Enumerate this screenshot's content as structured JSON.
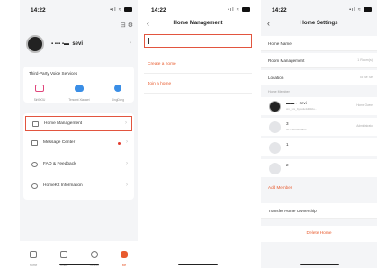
{
  "status": {
    "time": "14:22",
    "signal": "•ıl ≈"
  },
  "screen1": {
    "profile_name": "sevi",
    "voice_section_title": "Third-Party Voice Services",
    "voice_services": [
      {
        "label": "Siri/DOU",
        "color": "#e0457b"
      },
      {
        "label": "Tencent Xiaowei",
        "color": "#3a8ee6"
      },
      {
        "label": "DingDong",
        "color": "#3a8ee6"
      }
    ],
    "menu": [
      {
        "label": "Home Management"
      },
      {
        "label": "Message Center"
      },
      {
        "label": "FAQ & Feedback"
      },
      {
        "label": "HomeKit Information"
      }
    ],
    "tabs": [
      {
        "label": "Home"
      },
      {
        "label": "Smart"
      },
      {
        "label": "Service"
      },
      {
        "label": "Me"
      }
    ]
  },
  "screen2": {
    "title": "Home Management",
    "input_value": "",
    "create_label": "Create a home",
    "join_label": "Join a home"
  },
  "screen3": {
    "title": "Home Settings",
    "rows": [
      {
        "label": "Home Name",
        "value": ""
      },
      {
        "label": "Room Management",
        "value": "1 Room(s)"
      },
      {
        "label": "Location",
        "value": "To Be Se"
      }
    ],
    "members_section": "Home Member",
    "members": [
      {
        "name": "sevi",
        "sub": "cm_xxx_bycxdu4d0S0u...",
        "role": "Home Owner"
      },
      {
        "name": "3",
        "sub": "00 10003300804",
        "role": "Administrator"
      },
      {
        "name": "1",
        "sub": "",
        "role": ""
      },
      {
        "name": "2",
        "sub": "",
        "role": ""
      }
    ],
    "add_member": "Add Member",
    "transfer": "Transfer Home Ownership",
    "delete": "Delete Home"
  },
  "colors": {
    "accent": "#e85b2e",
    "highlight": "#e2553f"
  }
}
